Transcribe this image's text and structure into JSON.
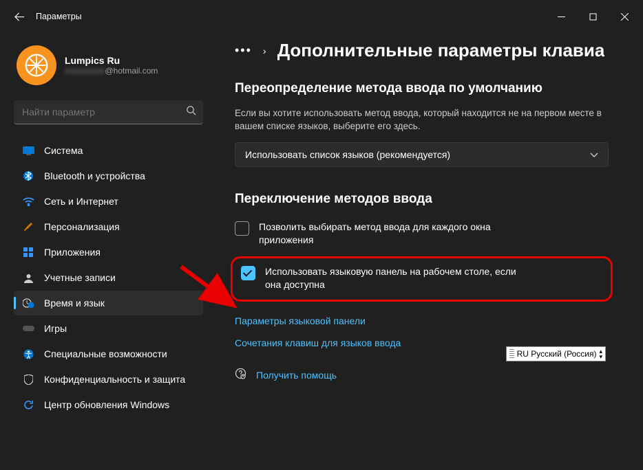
{
  "window": {
    "title": "Параметры"
  },
  "profile": {
    "name": "Lumpics Ru",
    "email_suffix": "@hotmail.com"
  },
  "search": {
    "placeholder": "Найти параметр"
  },
  "nav": {
    "system": "Система",
    "bluetooth": "Bluetooth и устройства",
    "network": "Сеть и Интернет",
    "personalization": "Персонализация",
    "apps": "Приложения",
    "accounts": "Учетные записи",
    "time": "Время и язык",
    "gaming": "Игры",
    "accessibility": "Специальные возможности",
    "privacy": "Конфиденциальность и защита",
    "update": "Центр обновления Windows"
  },
  "breadcrumb": {
    "title": "Дополнительные параметры клавиа"
  },
  "section1": {
    "title": "Переопределение метода ввода по умолчанию",
    "desc": "Если вы хотите использовать метод ввода, который находится не на первом месте в вашем списке языков, выберите его здесь.",
    "dropdown": "Использовать список языков (рекомендуется)"
  },
  "section2": {
    "title": "Переключение методов ввода",
    "check1": "Позволить выбирать метод ввода для каждого окна приложения",
    "check2": "Использовать языковую панель на рабочем столе, если она доступна",
    "link1": "Параметры языковой панели",
    "link2": "Сочетания клавиш для языков ввода"
  },
  "help": "Получить помощь",
  "langbar": "RU Русский (Россия)"
}
